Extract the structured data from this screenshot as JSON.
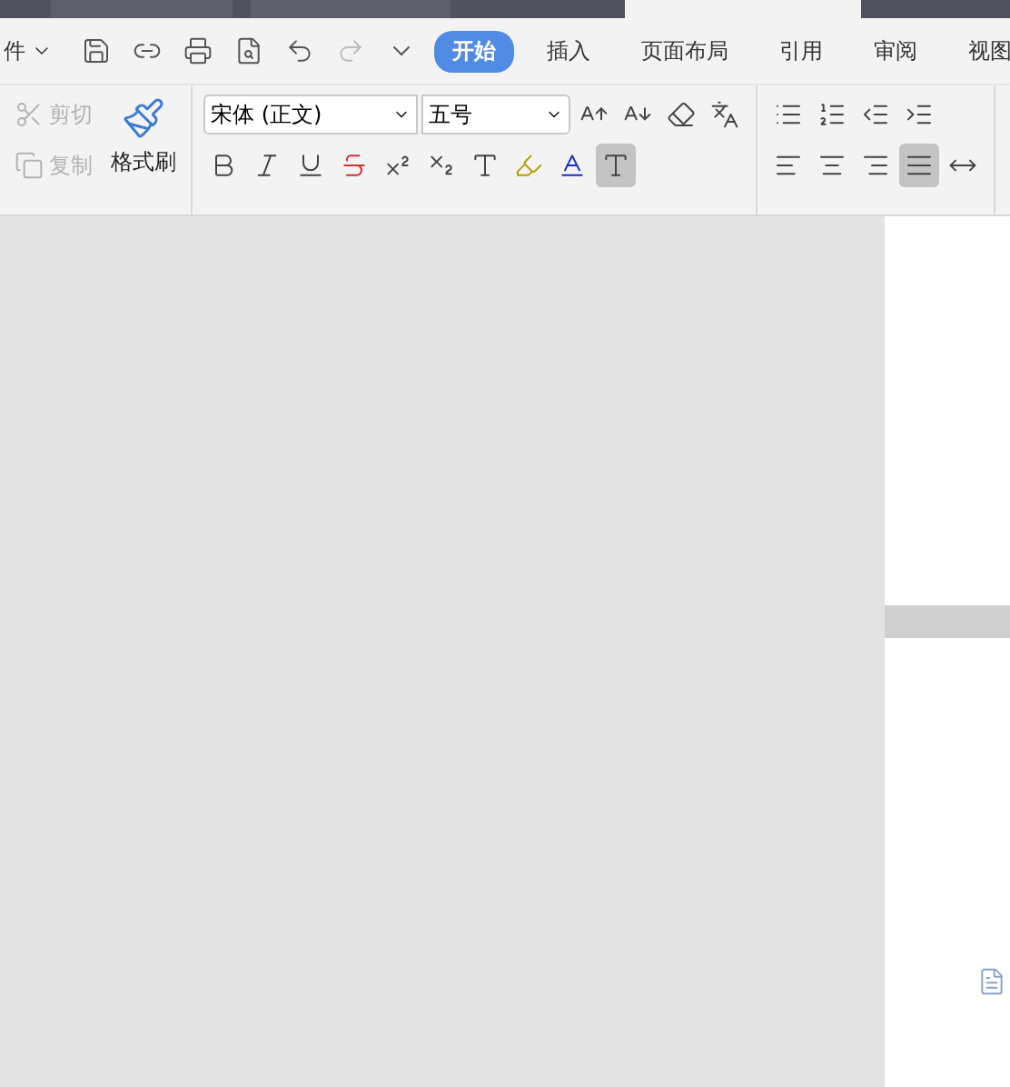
{
  "document_tabs": [
    {
      "selected": false
    },
    {
      "selected": false
    },
    {
      "selected": true
    }
  ],
  "menu": {
    "file_label": "件"
  },
  "ribbon_tabs": [
    {
      "label": "开始",
      "selected": true
    },
    {
      "label": "插入",
      "selected": false
    },
    {
      "label": "页面布局",
      "selected": false
    },
    {
      "label": "引用",
      "selected": false
    },
    {
      "label": "审阅",
      "selected": false
    },
    {
      "label": "视图",
      "selected": false
    }
  ],
  "clipboard": [
    {
      "label": "剪切",
      "kind": "cut",
      "disabled": true
    },
    {
      "label": "复制",
      "kind": "copy",
      "disabled": true
    }
  ],
  "format_painter": {
    "label": "格式刷"
  },
  "font": {
    "name": "宋体 (正文)",
    "size": "五号"
  },
  "font_tools": [
    {
      "kind": "grow",
      "selected": false
    },
    {
      "kind": "shrink",
      "selected": false
    },
    {
      "kind": "clear",
      "selected": false
    },
    {
      "kind": "phonetic",
      "selected": false
    }
  ],
  "format_buttons": [
    {
      "kind": "bold",
      "selected": false
    },
    {
      "kind": "italic",
      "selected": false
    },
    {
      "kind": "underline",
      "selected": false
    },
    {
      "kind": "strike",
      "selected": false
    },
    {
      "kind": "superscript",
      "selected": false
    },
    {
      "kind": "subscript",
      "selected": false
    },
    {
      "kind": "effect",
      "selected": false
    },
    {
      "kind": "highlight",
      "selected": false
    },
    {
      "kind": "color",
      "selected": false
    },
    {
      "kind": "shading",
      "selected": true
    }
  ],
  "list_tools": [
    {
      "kind": "bullets"
    },
    {
      "kind": "numbering"
    },
    {
      "kind": "outdent"
    },
    {
      "kind": "indent"
    }
  ],
  "alignment": [
    {
      "kind": "left",
      "selected": false
    },
    {
      "kind": "center",
      "selected": false
    },
    {
      "kind": "right",
      "selected": false
    },
    {
      "kind": "justify",
      "selected": true
    },
    {
      "kind": "distribute",
      "selected": false
    }
  ]
}
